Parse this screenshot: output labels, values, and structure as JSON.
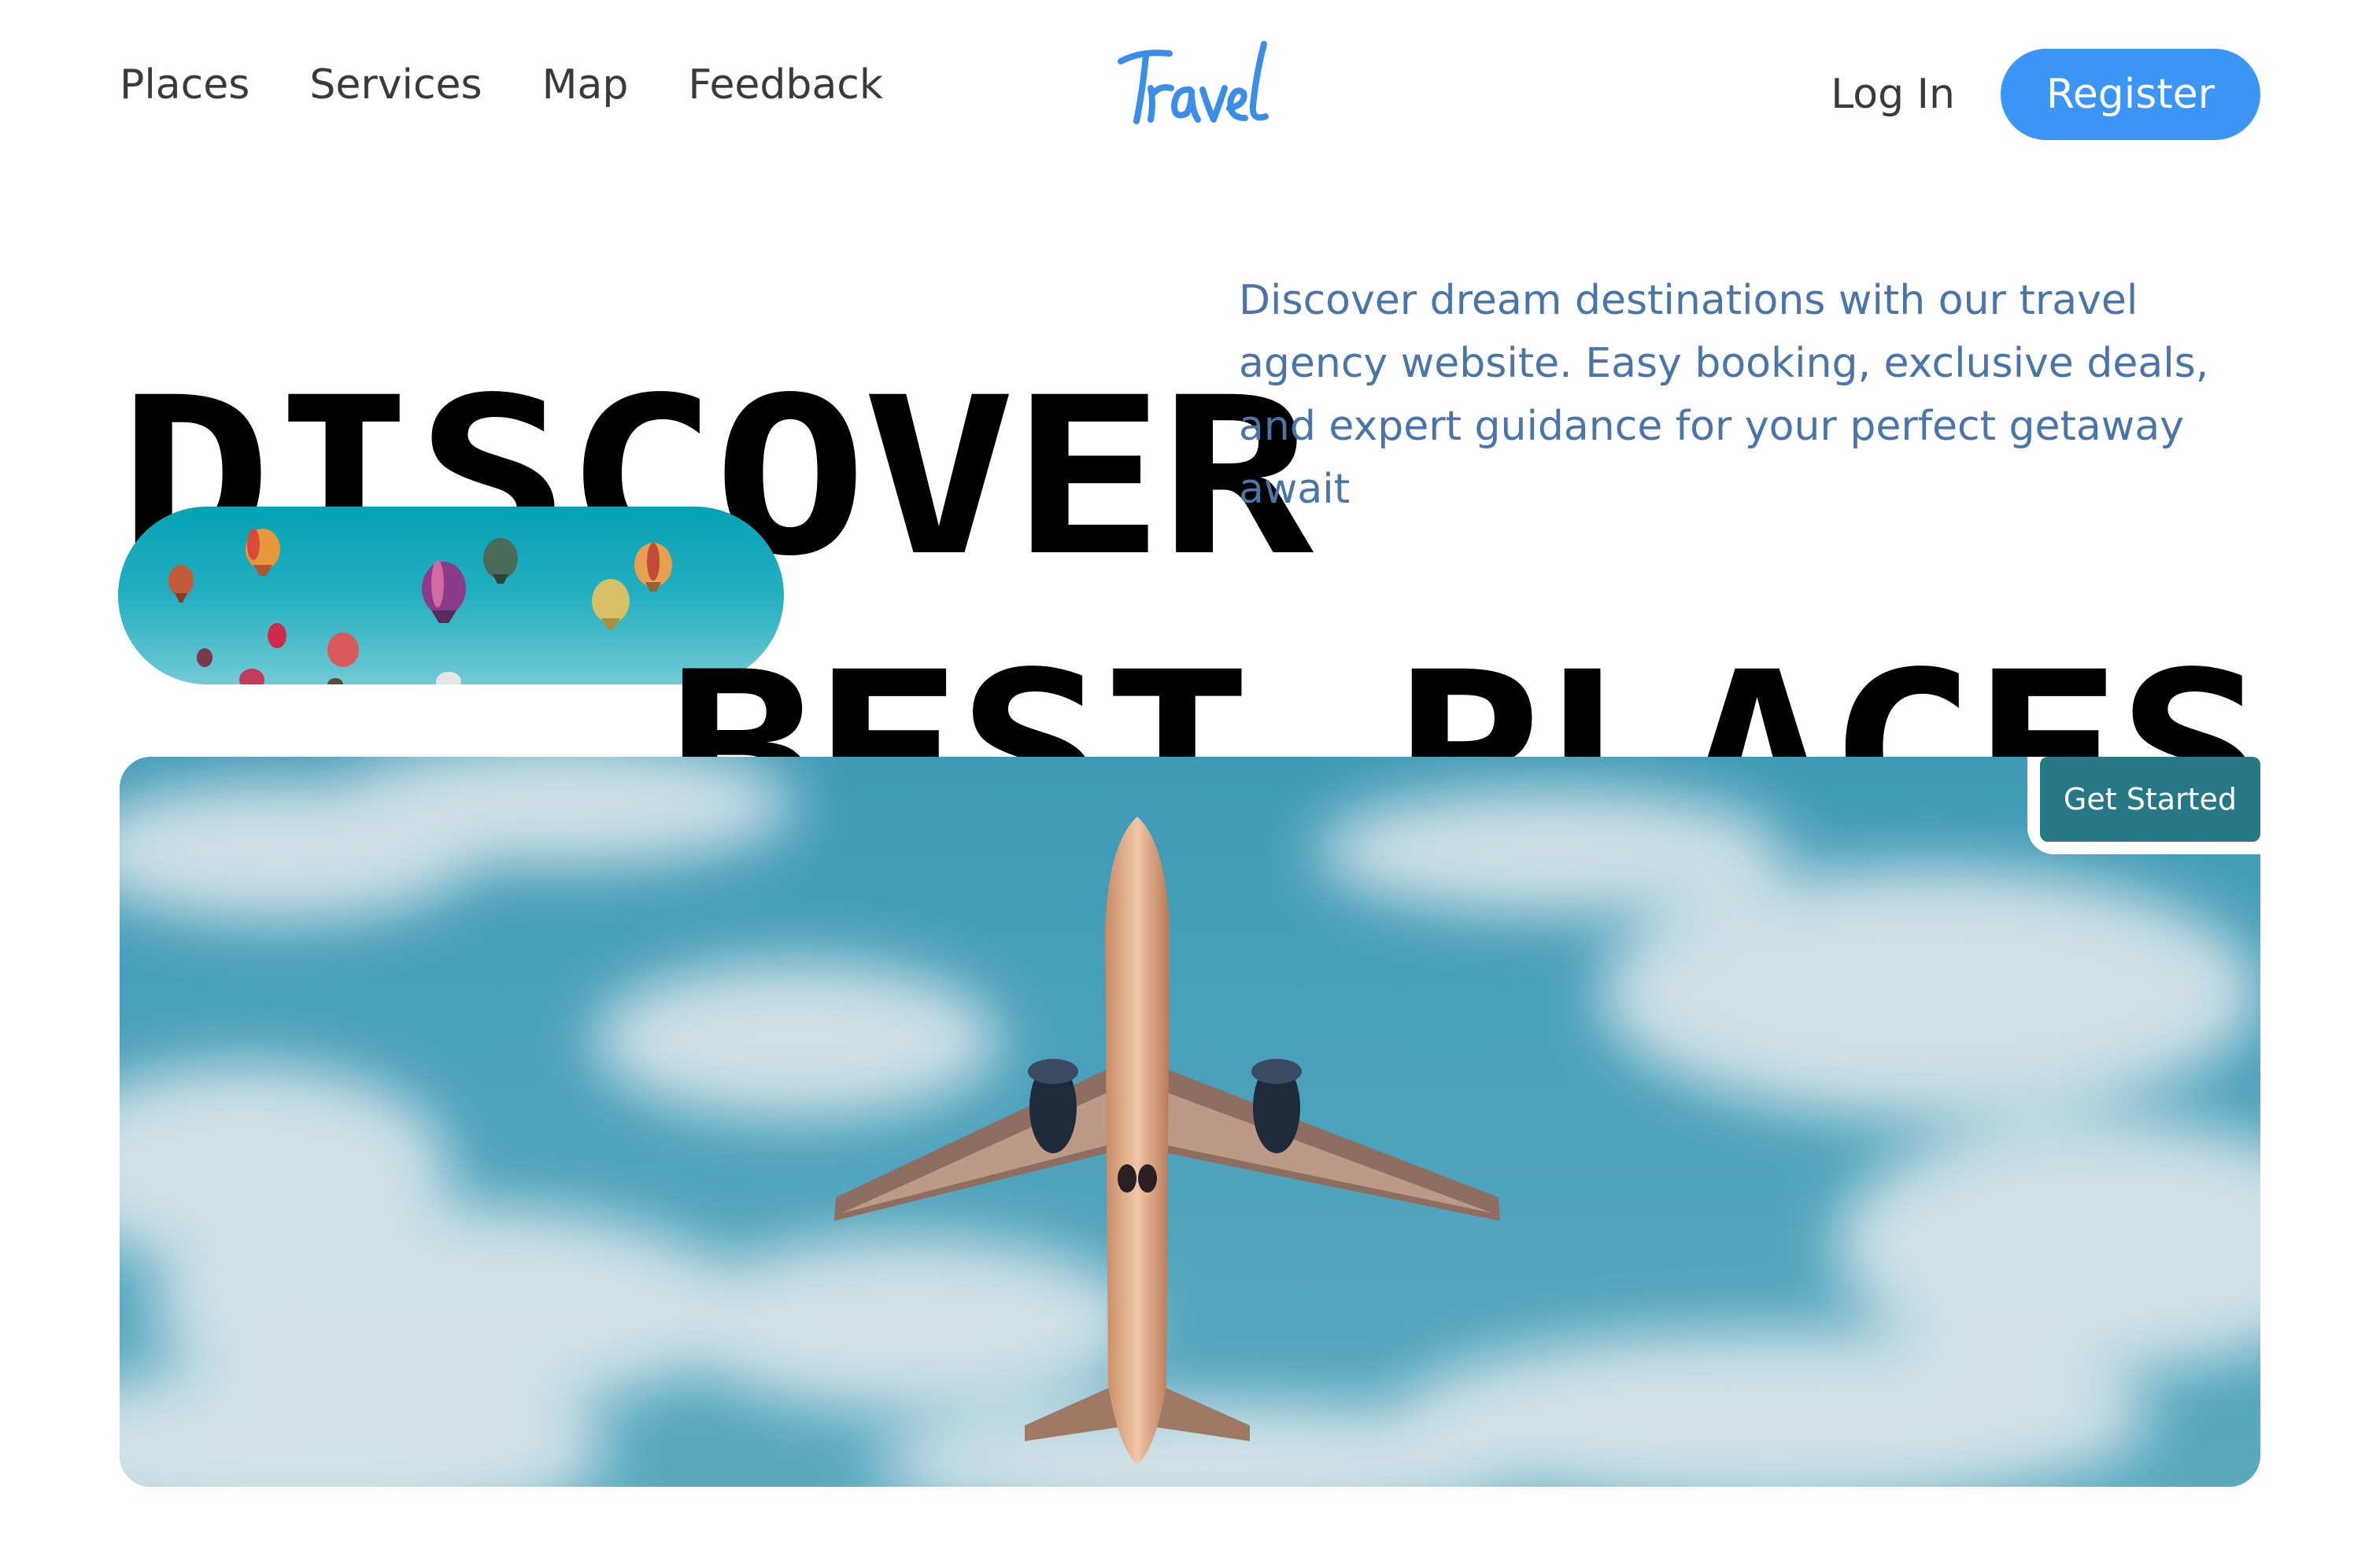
{
  "nav": {
    "links": [
      "Places",
      "Services",
      "Map",
      "Feedback"
    ],
    "logo_text": "Travel",
    "login_label": "Log In",
    "register_label": "Register"
  },
  "hero": {
    "line1": "DISCOVER",
    "line2": "BEST PLACES",
    "tagline": "Discover dream destinations with our travel agency website. Easy booking, exclusive deals, and expert guidance for your perfect getaway await",
    "cta_label": "Get Started"
  },
  "colors": {
    "accent": "#3b95f6",
    "tagline": "#4a75a8",
    "cta": "#257884"
  },
  "images": {
    "pill": "hot-air-balloons",
    "main": "airplane-in-sky"
  }
}
